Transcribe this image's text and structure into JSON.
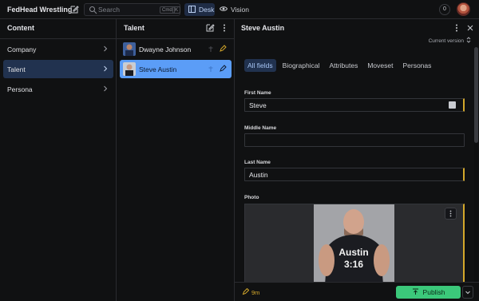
{
  "app": {
    "title": "FedHead Wrestling"
  },
  "search": {
    "placeholder": "Search",
    "shortcut_key1": "Cmd",
    "shortcut_key2": "K"
  },
  "modes": {
    "desk": "Desk",
    "vision": "Vision"
  },
  "notifications": {
    "count": "0"
  },
  "content_pane": {
    "title": "Content",
    "items": [
      {
        "label": "Company"
      },
      {
        "label": "Talent"
      },
      {
        "label": "Persona"
      }
    ]
  },
  "talent_pane": {
    "title": "Talent",
    "items": [
      {
        "name": "Dwayne Johnson"
      },
      {
        "name": "Steve Austin"
      }
    ]
  },
  "document": {
    "title": "Steve Austin",
    "version": "Current version",
    "tabs": [
      "All fields",
      "Biographical",
      "Attributes",
      "Moveset",
      "Personas"
    ],
    "fields": {
      "first_name": {
        "label": "First Name",
        "value": "Steve"
      },
      "middle_name": {
        "label": "Middle Name",
        "value": ""
      },
      "last_name": {
        "label": "Last Name",
        "value": "Austin"
      },
      "photo": {
        "label": "Photo",
        "shirt_line1": "Austin",
        "shirt_line2": "3:16"
      }
    },
    "footer": {
      "edited": "9m",
      "publish": "Publish"
    }
  },
  "colors": {
    "accent": "#5b9df7",
    "publish": "#3bc87a",
    "changed": "#d4a82b",
    "background": "#101112"
  }
}
